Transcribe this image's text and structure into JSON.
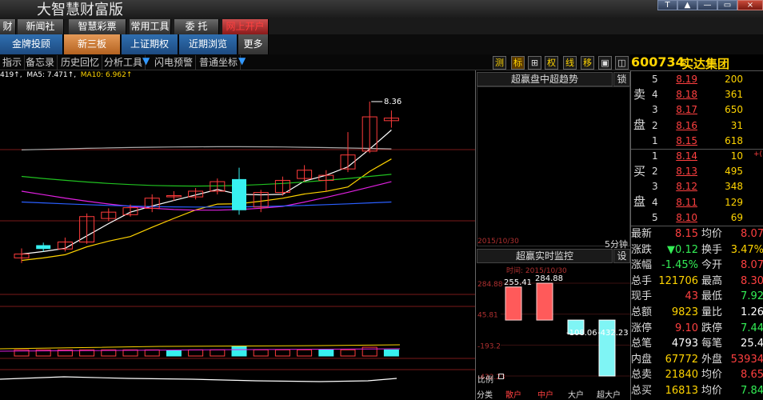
{
  "app": {
    "title": "大智慧财富版"
  },
  "window_buttons": [
    "T",
    "▲",
    "—",
    "▭",
    "×"
  ],
  "menu": [
    {
      "label": "财",
      "red": false
    },
    {
      "label": "新闻社",
      "red": false
    },
    {
      "label": "智慧彩票",
      "red": false
    },
    {
      "label": "常用工具",
      "red": false
    },
    {
      "label": "委 托",
      "red": false
    },
    {
      "label": "网上开户",
      "red": true
    }
  ],
  "tabs": [
    {
      "label": "金牌投顾",
      "active": false
    },
    {
      "label": "新三板",
      "active": true
    },
    {
      "label": "上证期权",
      "active": false
    },
    {
      "label": "近期浏览",
      "active": false
    },
    {
      "label": "更多",
      "active": false
    }
  ],
  "toolbar": {
    "items": [
      "指示",
      "备忘录",
      "历史回忆",
      "分析工具",
      "闪电预警",
      "普通坐标"
    ],
    "right_buttons": [
      "测",
      "标",
      "⊞",
      "权",
      "线",
      "移",
      "▣",
      "◫"
    ]
  },
  "indicator_line": {
    "ma_fast": "419↑",
    "ma5": "MA5: 7.471↑",
    "ma10": "MA10: 6.962↑"
  },
  "chart_data": {
    "type": "candlestick",
    "annotation_high": "8.36",
    "candles": [
      {
        "o": 5.9,
        "c": 5.96,
        "h": 6.05,
        "l": 5.82
      },
      {
        "o": 6.1,
        "c": 6.04,
        "h": 6.14,
        "l": 6.0
      },
      {
        "o": 6.04,
        "c": 6.15,
        "h": 6.22,
        "l": 6.0
      },
      {
        "o": 6.15,
        "c": 6.55,
        "h": 6.6,
        "l": 6.12
      },
      {
        "o": 6.52,
        "c": 6.62,
        "h": 6.68,
        "l": 6.48
      },
      {
        "o": 6.58,
        "c": 6.69,
        "h": 6.74,
        "l": 6.55
      },
      {
        "o": 6.68,
        "c": 6.84,
        "h": 6.9,
        "l": 6.62
      },
      {
        "o": 6.87,
        "c": 6.88,
        "h": 6.95,
        "l": 6.8
      },
      {
        "o": 6.86,
        "c": 6.95,
        "h": 7.0,
        "l": 6.82
      },
      {
        "o": 6.95,
        "c": 7.1,
        "h": 7.15,
        "l": 6.9
      },
      {
        "o": 7.14,
        "c": 6.65,
        "h": 7.32,
        "l": 6.58
      },
      {
        "o": 6.7,
        "c": 6.93,
        "h": 6.97,
        "l": 6.62
      },
      {
        "o": 6.93,
        "c": 7.12,
        "h": 7.18,
        "l": 6.88
      },
      {
        "o": 7.15,
        "c": 7.28,
        "h": 7.36,
        "l": 7.1
      },
      {
        "o": 7.12,
        "c": 7.2,
        "h": 7.28,
        "l": 6.95
      },
      {
        "o": 7.3,
        "c": 7.52,
        "h": 7.88,
        "l": 7.25
      },
      {
        "o": 7.58,
        "c": 8.12,
        "h": 8.36,
        "l": 7.55
      },
      {
        "o": 8.06,
        "c": 8.1,
        "h": 8.22,
        "l": 7.95
      }
    ],
    "volume_colors": [
      "r",
      "r",
      "r",
      "r",
      "r",
      "r",
      "r",
      "c",
      "r",
      "r",
      "c",
      "r",
      "r",
      "r",
      "c",
      "r",
      "r",
      "c"
    ],
    "volume": [
      0.35,
      0.35,
      0.35,
      0.35,
      0.35,
      0.35,
      0.35,
      0.3,
      0.35,
      0.35,
      0.55,
      0.35,
      0.35,
      0.35,
      0.35,
      0.35,
      0.5,
      0.35
    ],
    "y_min": 5.3,
    "y_max": 8.7
  },
  "intraday_panel": {
    "title": "超赢盘中超趋势",
    "lock": "锁",
    "date": "2015/10/30",
    "period": "5分钟"
  },
  "monitor_panel": {
    "title": "超赢实时监控",
    "settings": "设",
    "time_label": "时间: 2015/10/30",
    "bars": [
      {
        "label": "255.41",
        "value": 255.41
      },
      {
        "label": "284.88",
        "value": 284.88
      },
      {
        "label": "-108.06",
        "value": -108.06
      },
      {
        "label": "-432.23",
        "value": -432.23
      }
    ],
    "axis": [
      "284.88",
      "45.81",
      "-193.2",
      "-432.23"
    ],
    "ratio_label": "比例",
    "bottom": [
      "分类",
      "散户",
      "中户",
      "大户",
      "超大户"
    ]
  },
  "quote": {
    "code": "600734",
    "name": "实达集团",
    "asks": [
      {
        "level": "5",
        "price": "8.19",
        "vol": "200"
      },
      {
        "level": "4",
        "price": "8.18",
        "vol": "361"
      },
      {
        "level": "3",
        "price": "8.17",
        "vol": "650"
      },
      {
        "level": "2",
        "price": "8.16",
        "vol": "31"
      },
      {
        "level": "1",
        "price": "8.15",
        "vol": "618"
      }
    ],
    "bids": [
      {
        "level": "1",
        "price": "8.14",
        "vol": "10"
      },
      {
        "level": "2",
        "price": "8.13",
        "vol": "495"
      },
      {
        "level": "3",
        "price": "8.12",
        "vol": "348"
      },
      {
        "level": "4",
        "price": "8.11",
        "vol": "129"
      },
      {
        "level": "5",
        "price": "8.10",
        "vol": "69"
      }
    ],
    "sell_label": [
      "卖",
      "盘"
    ],
    "buy_label": [
      "买",
      "盘"
    ],
    "stats": [
      {
        "l": "最新",
        "v": "8.15",
        "vc": "red",
        "l2": "均价",
        "v2": "8.07",
        "v2c": "red"
      },
      {
        "l": "涨跌",
        "v": "▼0.12",
        "vc": "grn",
        "l2": "换手",
        "v2": "3.47%",
        "v2c": "yel"
      },
      {
        "l": "涨幅",
        "v": "-1.45%",
        "vc": "grn",
        "l2": "今开",
        "v2": "8.07",
        "v2c": "red"
      },
      {
        "l": "总手",
        "v": "121706",
        "vc": "yel",
        "l2": "最高",
        "v2": "8.30",
        "v2c": "red"
      },
      {
        "l": "现手",
        "v": "43",
        "vc": "red",
        "l2": "最低",
        "v2": "7.92",
        "v2c": "grn"
      },
      {
        "l": "总额",
        "v": "9823",
        "vc": "yel",
        "l2": "量比",
        "v2": "1.26",
        "v2c": "wht"
      },
      {
        "l": "涨停",
        "v": "9.10",
        "vc": "red",
        "l2": "跌停",
        "v2": "7.44",
        "v2c": "grn"
      },
      {
        "l": "总笔",
        "v": "4793",
        "vc": "wht",
        "l2": "每笔",
        "v2": "25.4",
        "v2c": "wht"
      },
      {
        "l": "内盘",
        "v": "67772",
        "vc": "yel",
        "l2": "外盘",
        "v2": "53934",
        "v2c": "red"
      },
      {
        "l": "总卖",
        "v": "21840",
        "vc": "yel",
        "l2": "均价",
        "v2": "8.65",
        "v2c": "red"
      },
      {
        "l": "总买",
        "v": "16813",
        "vc": "yel",
        "l2": "均价",
        "v2": "7.84",
        "v2c": "grn"
      }
    ]
  }
}
